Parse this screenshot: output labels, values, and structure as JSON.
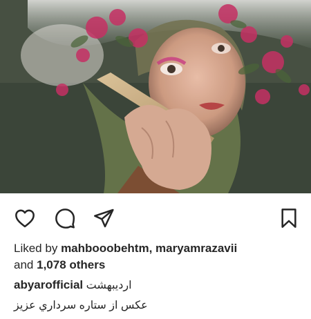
{
  "post": {
    "username": "abyarofficial",
    "caption_line1": "اردیبهشت",
    "caption_line2": "عکس از ستاره سرداري عزيز"
  },
  "likes": {
    "prefix": "Liked by",
    "user1": "mahbooobehtm",
    "separator": ",",
    "user2": "maryamrazavii",
    "and_text": "and",
    "others_count": "1,078 others"
  },
  "actions": {
    "like_icon": "heart-icon",
    "comment_icon": "comment-icon",
    "share_icon": "send-icon",
    "save_icon": "bookmark-icon"
  },
  "colors": {
    "text": "#262626",
    "icon": "#262626",
    "background": "#ffffff"
  }
}
